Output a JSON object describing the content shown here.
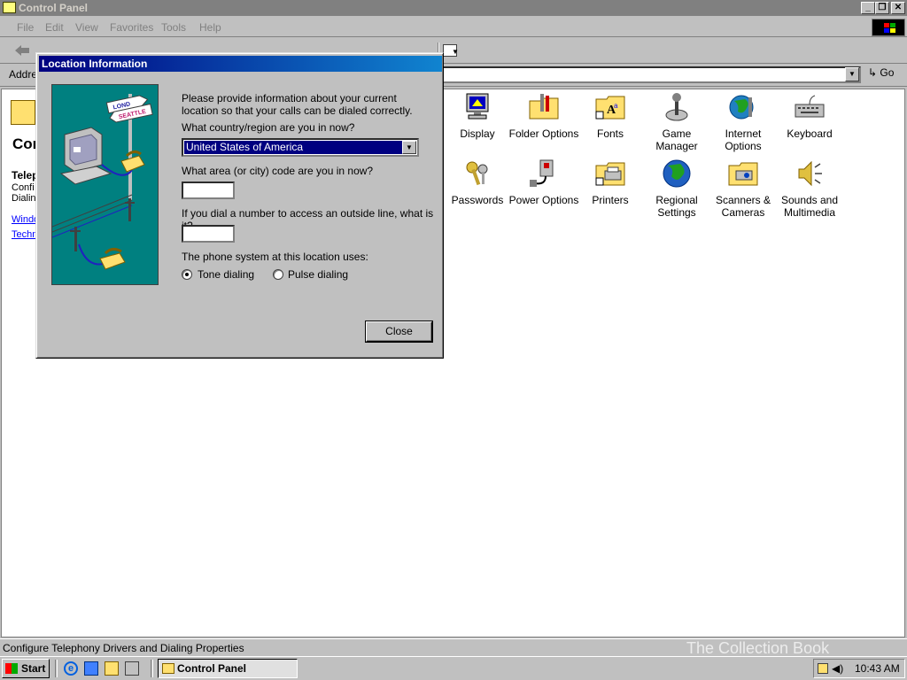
{
  "window": {
    "title": "Control Panel"
  },
  "menu": [
    "File",
    "Edit",
    "View",
    "Favorites",
    "Tools",
    "Help"
  ],
  "address": {
    "label": "Addre",
    "go": "Go"
  },
  "left_pane": {
    "title": "Con",
    "section": "Telep",
    "desc1": "Confi",
    "desc2": "Dialin",
    "link1": "Windo",
    "link2": "Techn"
  },
  "icons_row1": [
    "Display",
    "Folder Options",
    "Fonts",
    "Game Manager",
    "Internet Options",
    "Keyboard"
  ],
  "icons_row2": [
    "Passwords",
    "Power Options",
    "Printers",
    "Regional Settings",
    "Scanners & Cameras",
    "Sounds and Multimedia"
  ],
  "dialog": {
    "title": "Location Information",
    "intro": "Please provide information about your current location so that your calls can be dialed correctly.",
    "country_label": "What country/region are you in now?",
    "country_value": "United States of America",
    "area_label": "What area (or city) code are you in now?",
    "area_value": "",
    "outside_label": "If you dial a number to access an outside line, what is it?",
    "outside_value": "",
    "phone_system_label": "The phone system at this location uses:",
    "tone_label": "Tone dialing",
    "pulse_label": "Pulse dialing",
    "tone_selected": true,
    "close_label": "Close",
    "sign_top": "LOND",
    "sign_bottom": "SEATTLE"
  },
  "status": {
    "text": "Configure Telephony Drivers and Dialing Properties"
  },
  "taskbar": {
    "start": "Start",
    "task": "Control Panel",
    "clock": "10:43 AM"
  },
  "watermark": "The Collection Book",
  "colors": {
    "desktop": "#c0c0c0",
    "title_active": "#000080",
    "title_inactive": "#808080",
    "teal": "#008080"
  }
}
